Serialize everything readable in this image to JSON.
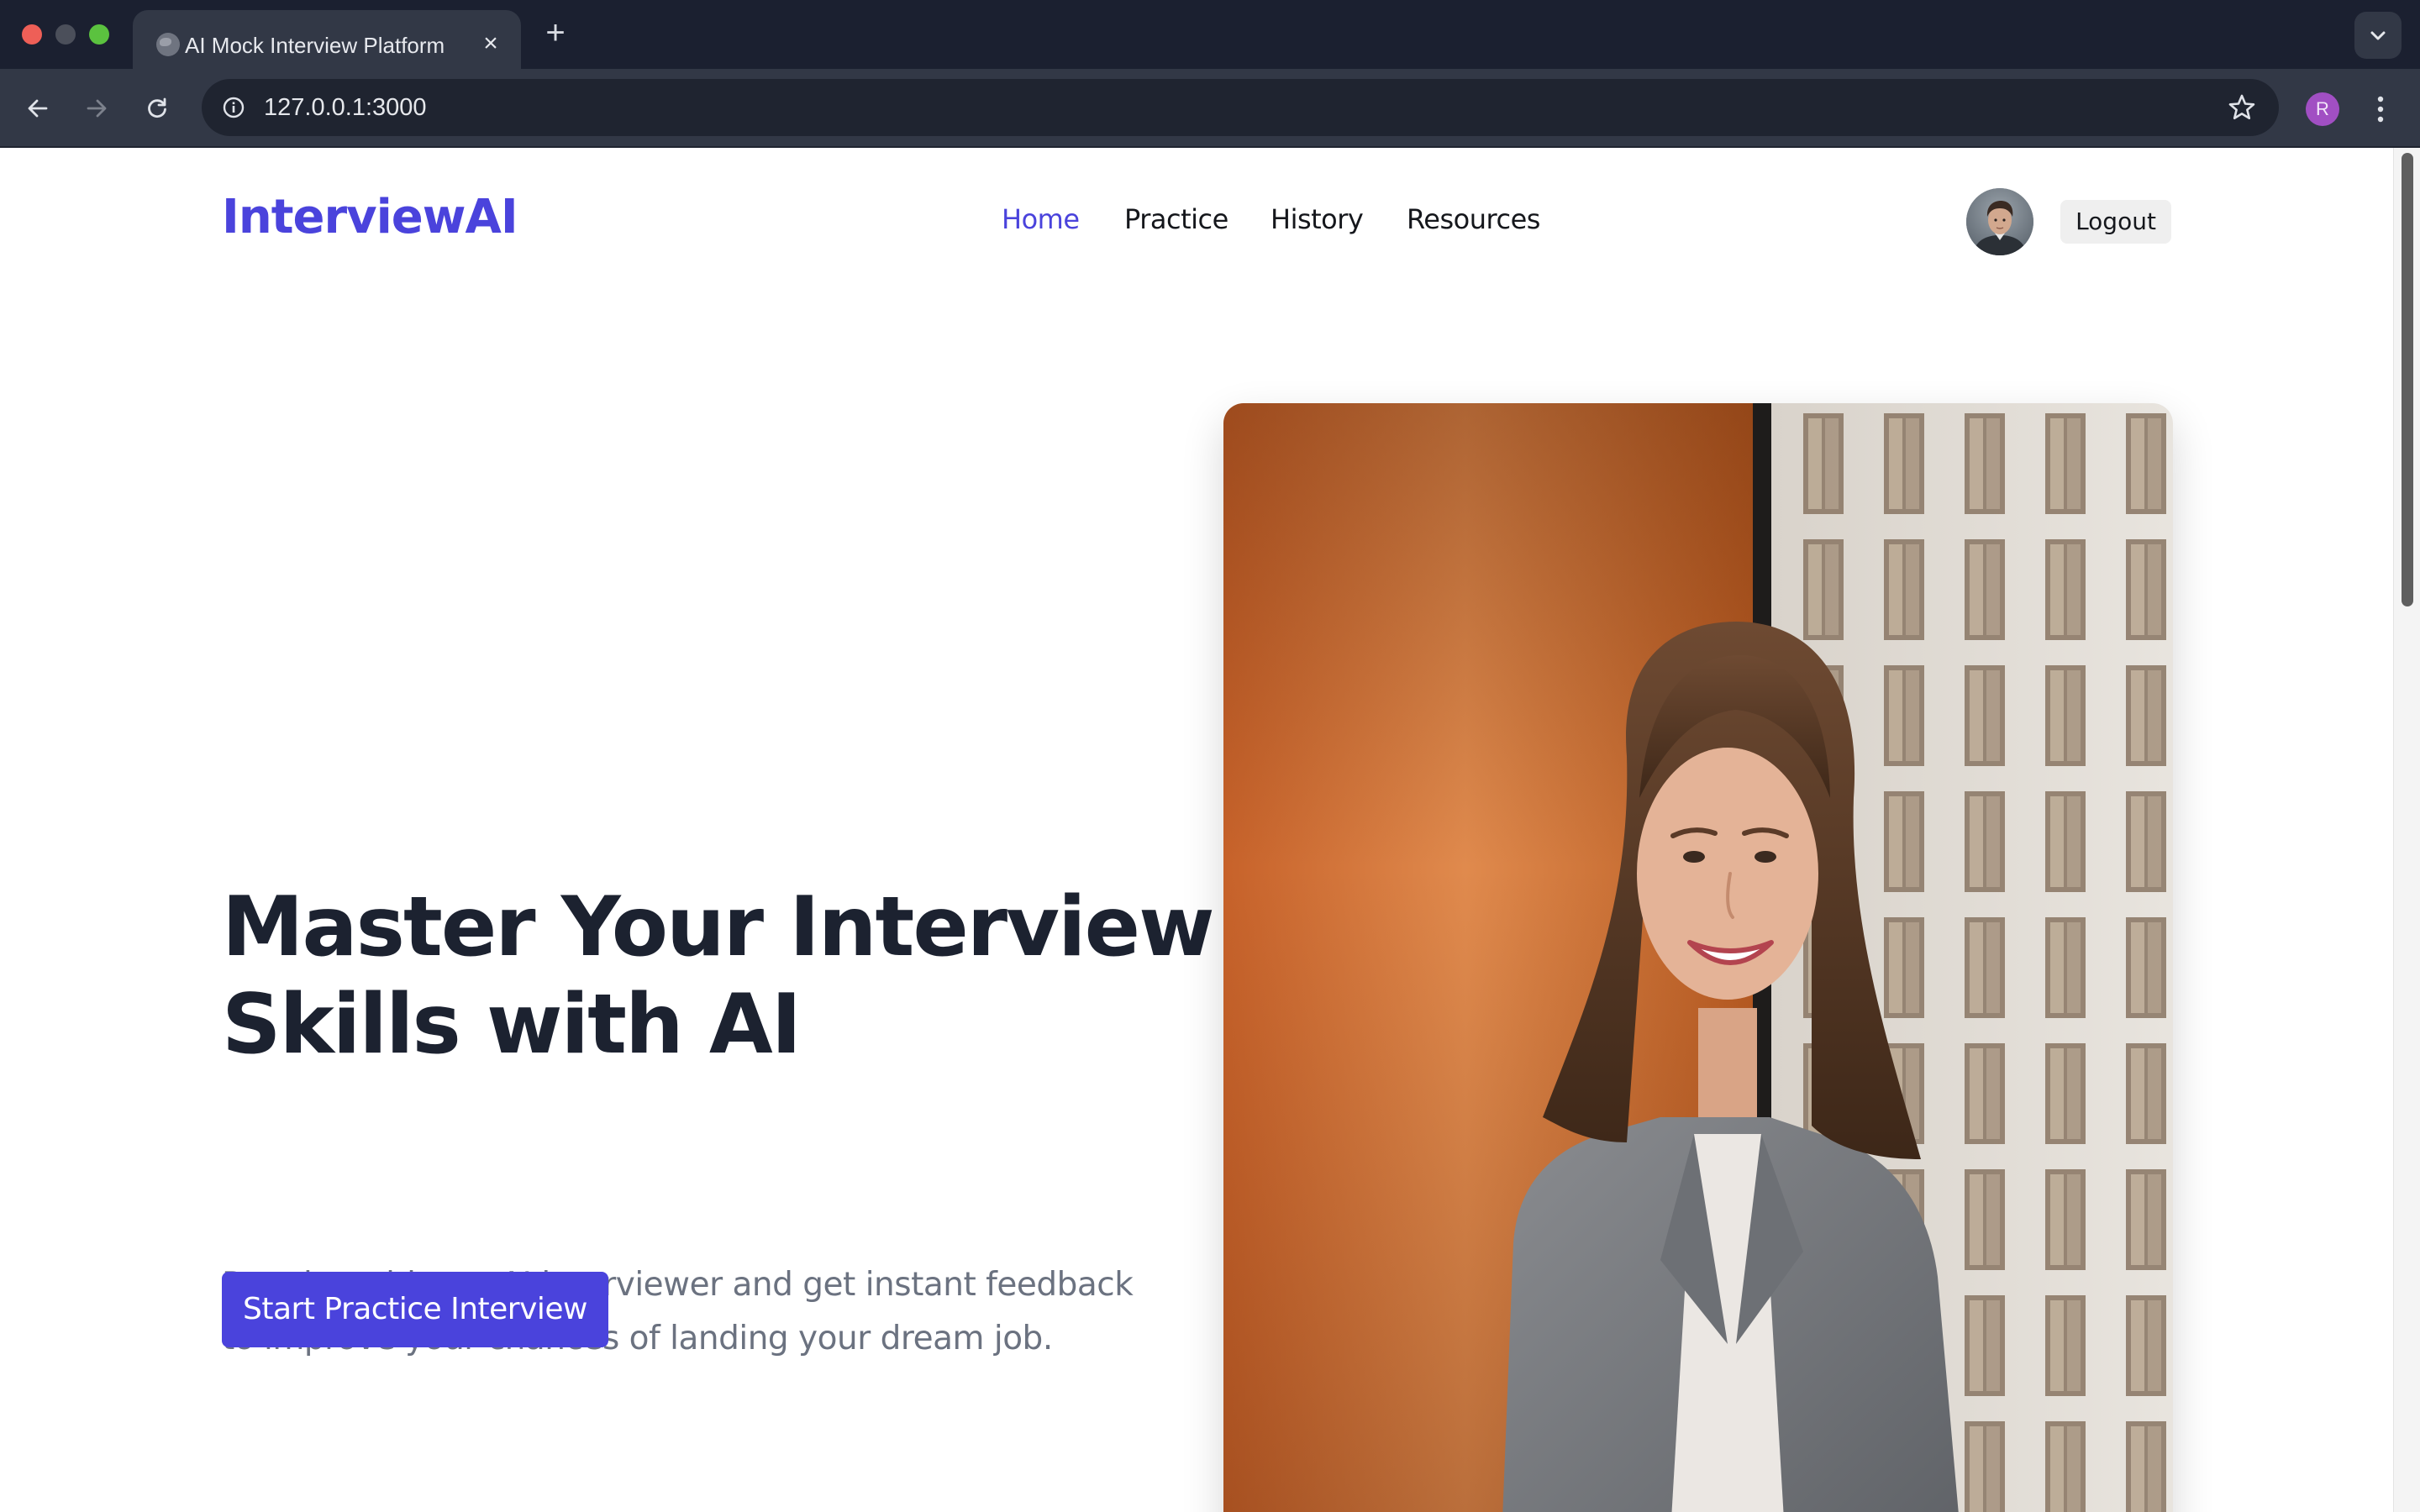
{
  "browser": {
    "tab_title": "AI Mock Interview Platform",
    "tab_close": "×",
    "new_tab": "+",
    "url": "127.0.0.1:3000",
    "profile_initial": "R"
  },
  "site": {
    "logo": "InterviewAI",
    "nav": [
      {
        "label": "Home",
        "active": true
      },
      {
        "label": "Practice",
        "active": false
      },
      {
        "label": "History",
        "active": false
      },
      {
        "label": "Resources",
        "active": false
      }
    ],
    "logout_label": "Logout"
  },
  "hero": {
    "title": "Master Your Interview Skills with AI",
    "subtitle": "Practice with our AI interviewer and get instant feedback to improve your chances of landing your dream job.",
    "cta_label": "Start Practice Interview"
  },
  "colors": {
    "brand": "#4a43dc",
    "heading": "#1c2230",
    "body_text": "#6b7280",
    "chrome_dark": "#1b2030",
    "chrome_toolbar": "#323846"
  },
  "icons": {
    "tab_favicon": "globe-icon",
    "back": "arrow-left-icon",
    "forward": "arrow-right-icon",
    "reload": "reload-icon",
    "site_info": "info-icon",
    "bookmark": "star-icon",
    "menu": "kebab-menu-icon",
    "tab_search": "chevron-down-icon"
  }
}
